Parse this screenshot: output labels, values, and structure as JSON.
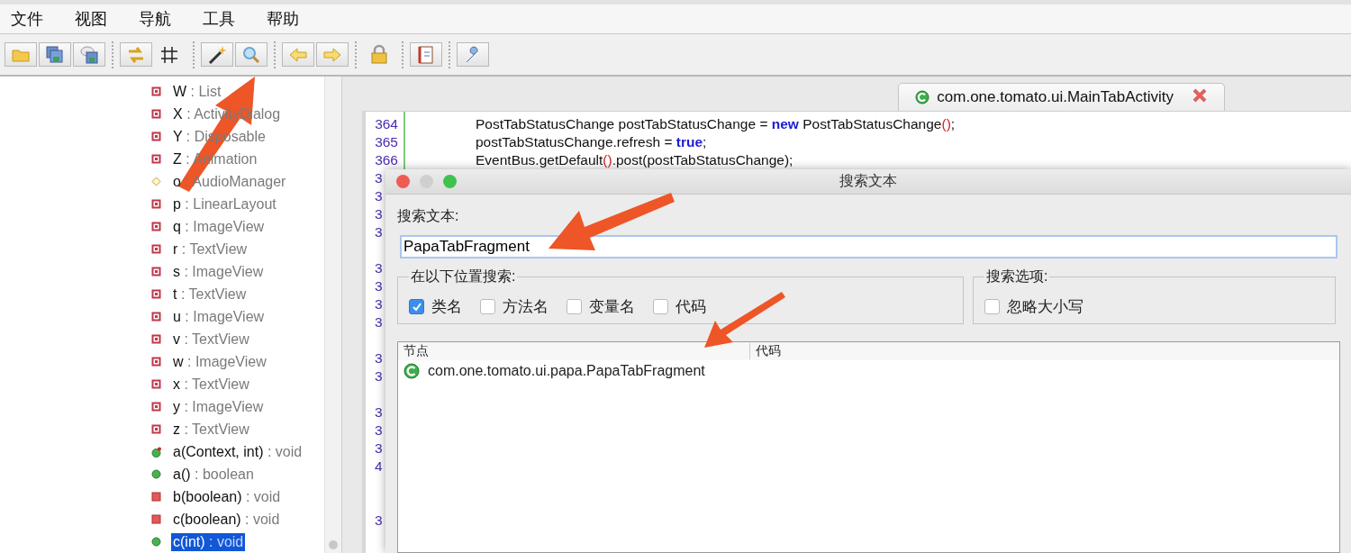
{
  "menu": [
    "文件",
    "视图",
    "导航",
    "工具",
    "帮助"
  ],
  "tree": [
    {
      "kind": "field-private",
      "name": "W",
      "type": ": List",
      "selected": false
    },
    {
      "kind": "field-private",
      "name": "X",
      "type": ": ActivityDialog",
      "selected": false
    },
    {
      "kind": "field-private",
      "name": "Y",
      "type": ": Disposable",
      "selected": false
    },
    {
      "kind": "field-private",
      "name": "Z",
      "type": ": Animation",
      "selected": false
    },
    {
      "kind": "field-package",
      "name": "o",
      "type": ": AudioManager",
      "selected": false
    },
    {
      "kind": "field-private",
      "name": "p",
      "type": ": LinearLayout",
      "selected": false
    },
    {
      "kind": "field-private",
      "name": "q",
      "type": ": ImageView",
      "selected": false
    },
    {
      "kind": "field-private",
      "name": "r",
      "type": ": TextView",
      "selected": false
    },
    {
      "kind": "field-private",
      "name": "s",
      "type": ": ImageView",
      "selected": false
    },
    {
      "kind": "field-private",
      "name": "t",
      "type": ": TextView",
      "selected": false
    },
    {
      "kind": "field-private",
      "name": "u",
      "type": ": ImageView",
      "selected": false
    },
    {
      "kind": "field-private",
      "name": "v",
      "type": ": TextView",
      "selected": false
    },
    {
      "kind": "field-private",
      "name": "w",
      "type": ": ImageView",
      "selected": false
    },
    {
      "kind": "field-private",
      "name": "x",
      "type": ": TextView",
      "selected": false
    },
    {
      "kind": "field-private",
      "name": "y",
      "type": ": ImageView",
      "selected": false
    },
    {
      "kind": "field-private",
      "name": "z",
      "type": ": TextView",
      "selected": false
    },
    {
      "kind": "method-static",
      "name": "a(Context, int)",
      "type": ": void",
      "selected": false
    },
    {
      "kind": "method-public",
      "name": "a()",
      "type": ": boolean",
      "selected": false
    },
    {
      "kind": "method-private",
      "name": "b(boolean)",
      "type": ": void",
      "selected": false
    },
    {
      "kind": "method-private",
      "name": "c(boolean)",
      "type": ": void",
      "selected": false
    },
    {
      "kind": "method-public",
      "name": "c(int)",
      "type": ": void",
      "selected": true
    }
  ],
  "editor_tab": {
    "title": "com.one.tomato.ui.MainTabActivity"
  },
  "code": [
    {
      "num": "364",
      "tokens": [
        {
          "kind": "plain",
          "text": "PostTabStatusChange postTabStatusChange = "
        },
        {
          "kind": "keyword",
          "text": "new"
        },
        {
          "kind": "plain",
          "text": " PostTabStatusChange"
        },
        {
          "kind": "paren",
          "text": "()"
        },
        {
          "kind": "plain",
          "text": ";"
        }
      ]
    },
    {
      "num": "365",
      "tokens": [
        {
          "kind": "plain",
          "text": "postTabStatusChange.refresh = "
        },
        {
          "kind": "keyword",
          "text": "true"
        },
        {
          "kind": "plain",
          "text": ";"
        }
      ]
    },
    {
      "num": "366",
      "tokens": [
        {
          "kind": "plain",
          "text": "EventBus.getDefault"
        },
        {
          "kind": "paren",
          "text": "()"
        },
        {
          "kind": "plain",
          "text": ".post(postTabStatusChange);"
        }
      ]
    }
  ],
  "hidden_gutter": [
    {
      "kind": "number",
      "num": "3"
    },
    {
      "kind": "number",
      "num": "3"
    },
    {
      "kind": "number",
      "num": "3"
    },
    {
      "kind": "number",
      "num": "3"
    },
    {
      "kind": "blank"
    },
    {
      "kind": "number",
      "num": "3"
    },
    {
      "kind": "number",
      "num": "3"
    },
    {
      "kind": "number",
      "num": "3"
    },
    {
      "kind": "number",
      "num": "3"
    },
    {
      "kind": "blank"
    },
    {
      "kind": "number",
      "num": "3"
    },
    {
      "kind": "number",
      "num": "3"
    },
    {
      "kind": "blank"
    },
    {
      "kind": "number",
      "num": "3"
    },
    {
      "kind": "number",
      "num": "3"
    },
    {
      "kind": "number",
      "num": "3"
    },
    {
      "kind": "number",
      "num": "4"
    },
    {
      "kind": "blank"
    },
    {
      "kind": "blank"
    },
    {
      "kind": "number",
      "num": "3"
    }
  ],
  "dialog": {
    "title": "搜索文本",
    "search_label": "搜索文本:",
    "search_value": "PapaTabFragment",
    "where_group": {
      "title": "在以下位置搜索:",
      "options": [
        {
          "label": "类名",
          "checked": true
        },
        {
          "label": "方法名",
          "checked": false
        },
        {
          "label": "变量名",
          "checked": false
        },
        {
          "label": "代码",
          "checked": false
        }
      ]
    },
    "options_group": {
      "title": "搜索选项:",
      "options": [
        {
          "label": "忽略大小写",
          "checked": false
        }
      ]
    },
    "results": {
      "columns": [
        "节点",
        "代码"
      ],
      "rows": [
        {
          "node": "com.one.tomato.ui.papa.PapaTabFragment"
        }
      ]
    }
  }
}
